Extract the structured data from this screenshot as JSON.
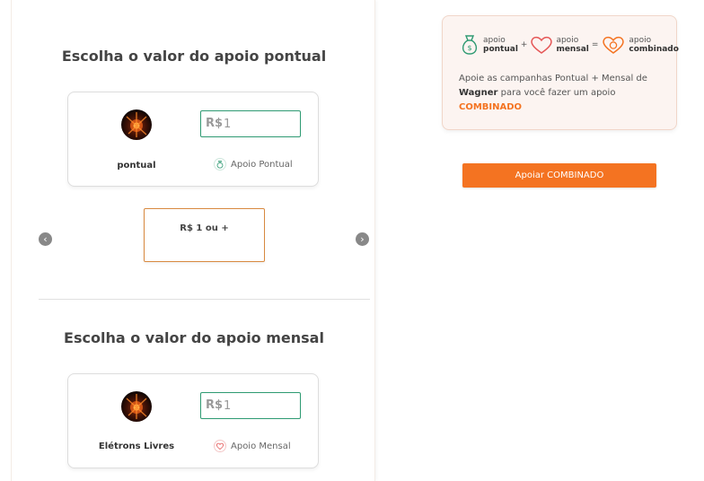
{
  "pontual_section": {
    "title": "Escolha o valor do apoio pontual",
    "campaign_name": "pontual",
    "currency": "R$",
    "amount_value": "1",
    "apoio_type_label": "Apoio Pontual",
    "carousel_option": "R$ 1 ou +"
  },
  "mensal_section": {
    "title": "Escolha o valor do apoio mensal",
    "campaign_name": "Elétrons Livres",
    "currency": "R$",
    "amount_value": "1",
    "apoio_type_label": "Apoio Mensal"
  },
  "combo": {
    "term_pontual_top": "apoio",
    "term_pontual_bottom": "pontual",
    "plus": "+",
    "term_mensal_top": "apoio",
    "term_mensal_bottom": "mensal",
    "equals": "=",
    "term_combinado_top": "apoio",
    "term_combinado_bottom": "combinado",
    "desc_prefix": "Apoie as campanhas Pontual + Mensal de ",
    "creator": "Wagner",
    "desc_middle": " para você fazer um apoio ",
    "desc_highlight": "COMBINADO"
  },
  "cta": {
    "label": "Apoiar COMBINADO"
  },
  "icons": {
    "prev": "chevron-left-icon",
    "next": "chevron-right-icon",
    "money_bag": "money-bag-icon",
    "heart": "heart-icon",
    "combined_heart": "combined-heart-icon"
  },
  "colors": {
    "accent": "#f47321",
    "green": "#2e9a72",
    "heart": "#e55656"
  }
}
